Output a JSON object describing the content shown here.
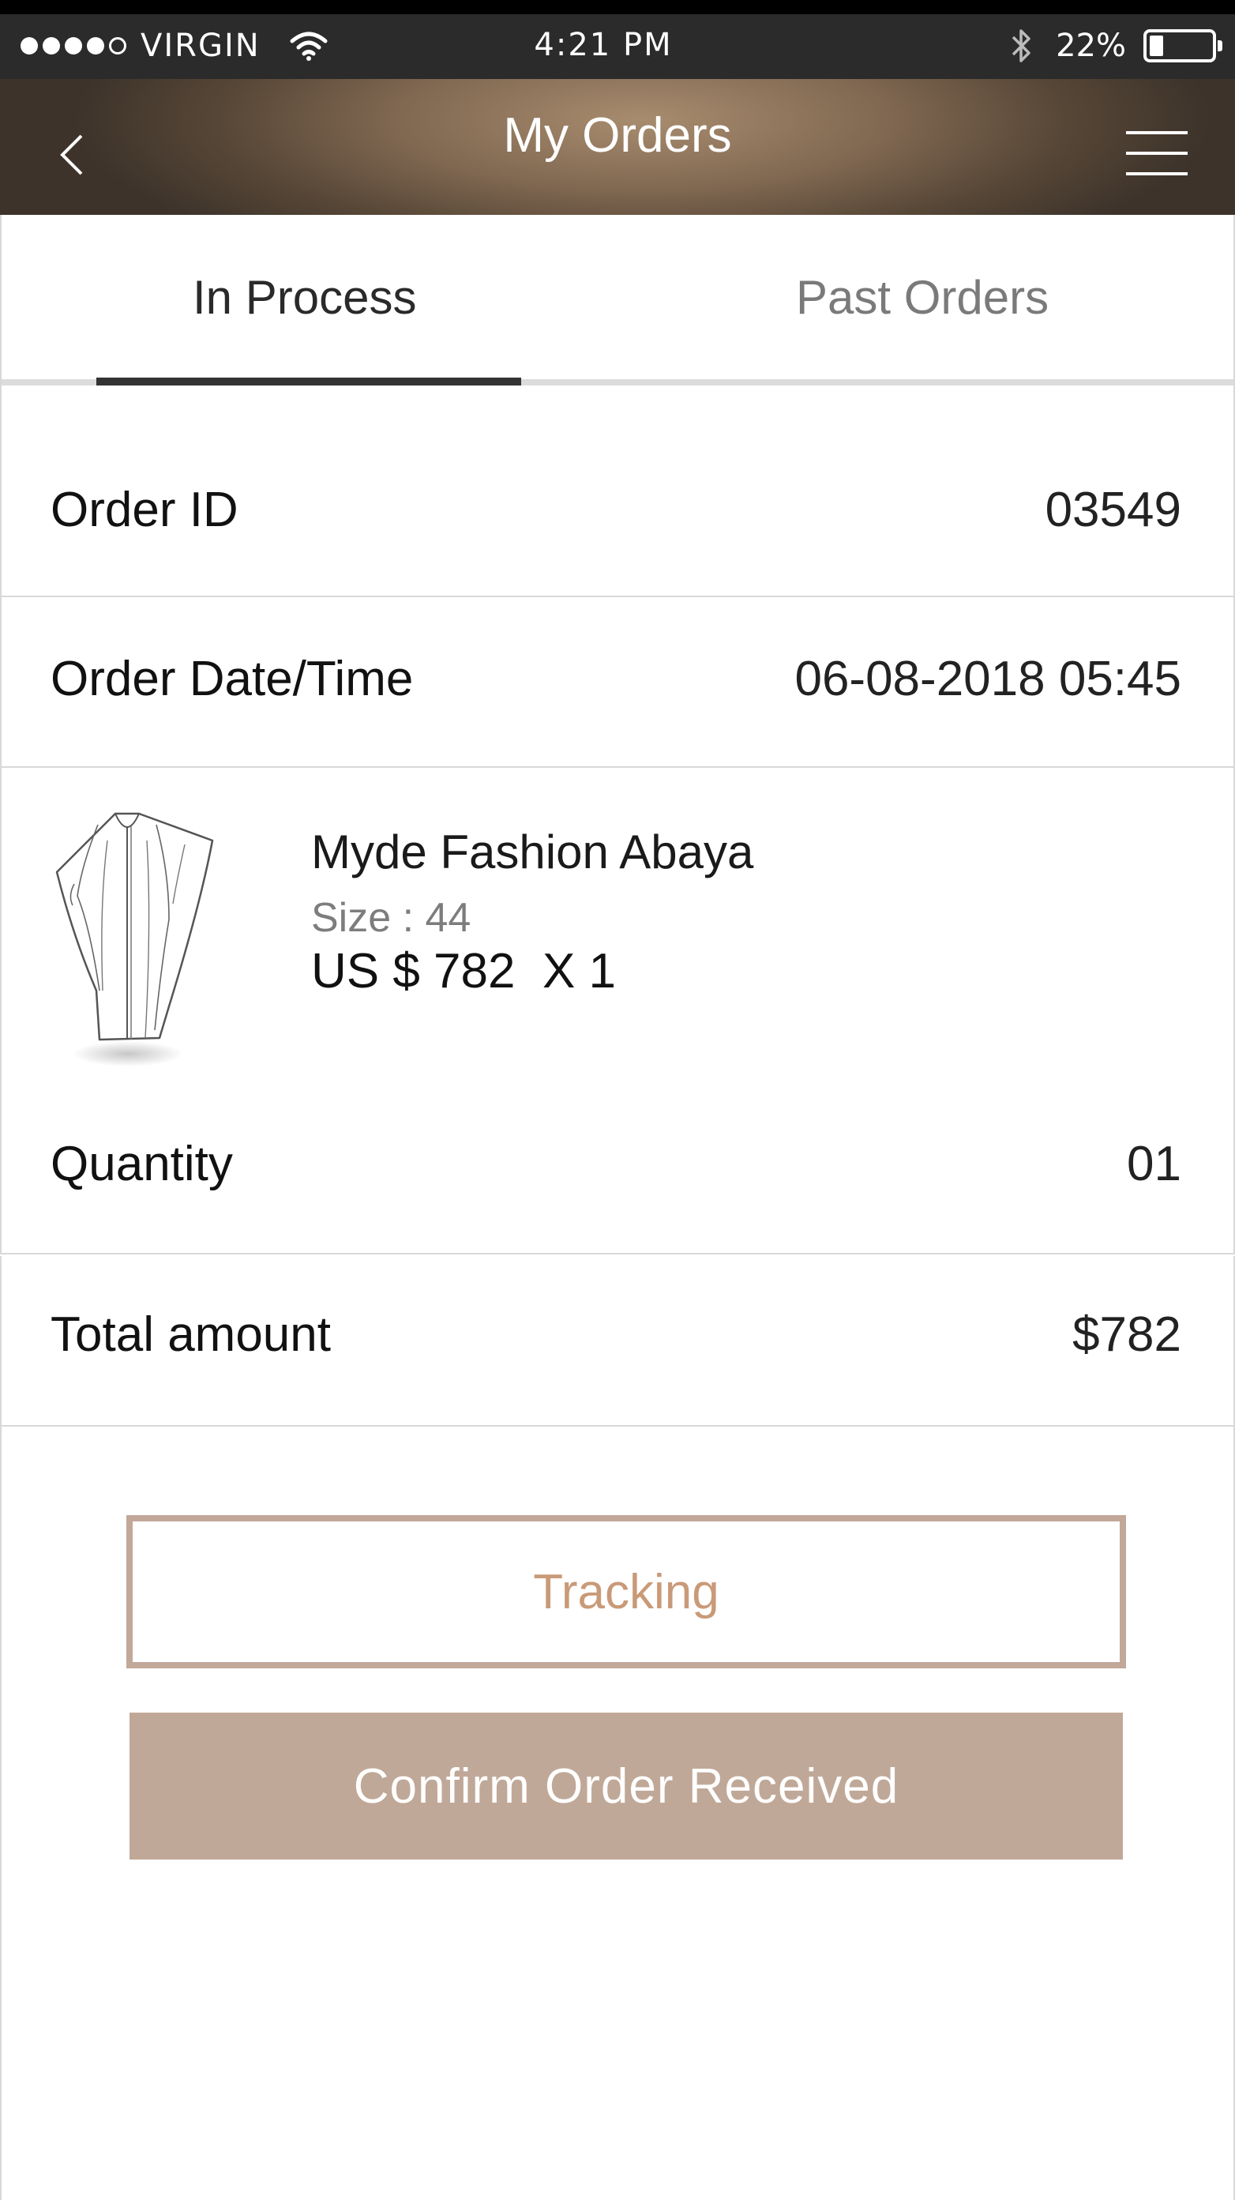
{
  "status_bar": {
    "carrier": "VIRGIN",
    "time": "4:21 PM",
    "battery_percent": "22%",
    "battery_level": 0.22,
    "signal_bars": 4,
    "icons": [
      "signal-dots",
      "wifi-icon",
      "bluetooth-icon",
      "battery-icon"
    ]
  },
  "nav": {
    "title": "My Orders",
    "back_icon": "chevron-left-icon",
    "menu_icon": "hamburger-menu-icon"
  },
  "tabs": [
    {
      "label": "In Process",
      "active": true
    },
    {
      "label": "Past Orders",
      "active": false
    }
  ],
  "order": {
    "id_label": "Order ID",
    "id_value": "03549",
    "date_label": "Order Date/Time",
    "date_value": "06-08-2018 05:45",
    "product": {
      "name": "Myde Fashion Abaya",
      "size": "Size : 44",
      "price": "US $ 782  X 1",
      "image_icon": "abaya-garment-illustration"
    },
    "quantity_label": "Quantity",
    "quantity_value": "01",
    "total_label": "Total amount",
    "total_value": "$782"
  },
  "actions": {
    "tracking_label": "Tracking",
    "confirm_label": "Confirm Order Received"
  },
  "colors": {
    "accent": "#c0a898",
    "tracking_text": "#c99a78",
    "status_bar": "#2b2b2b"
  }
}
